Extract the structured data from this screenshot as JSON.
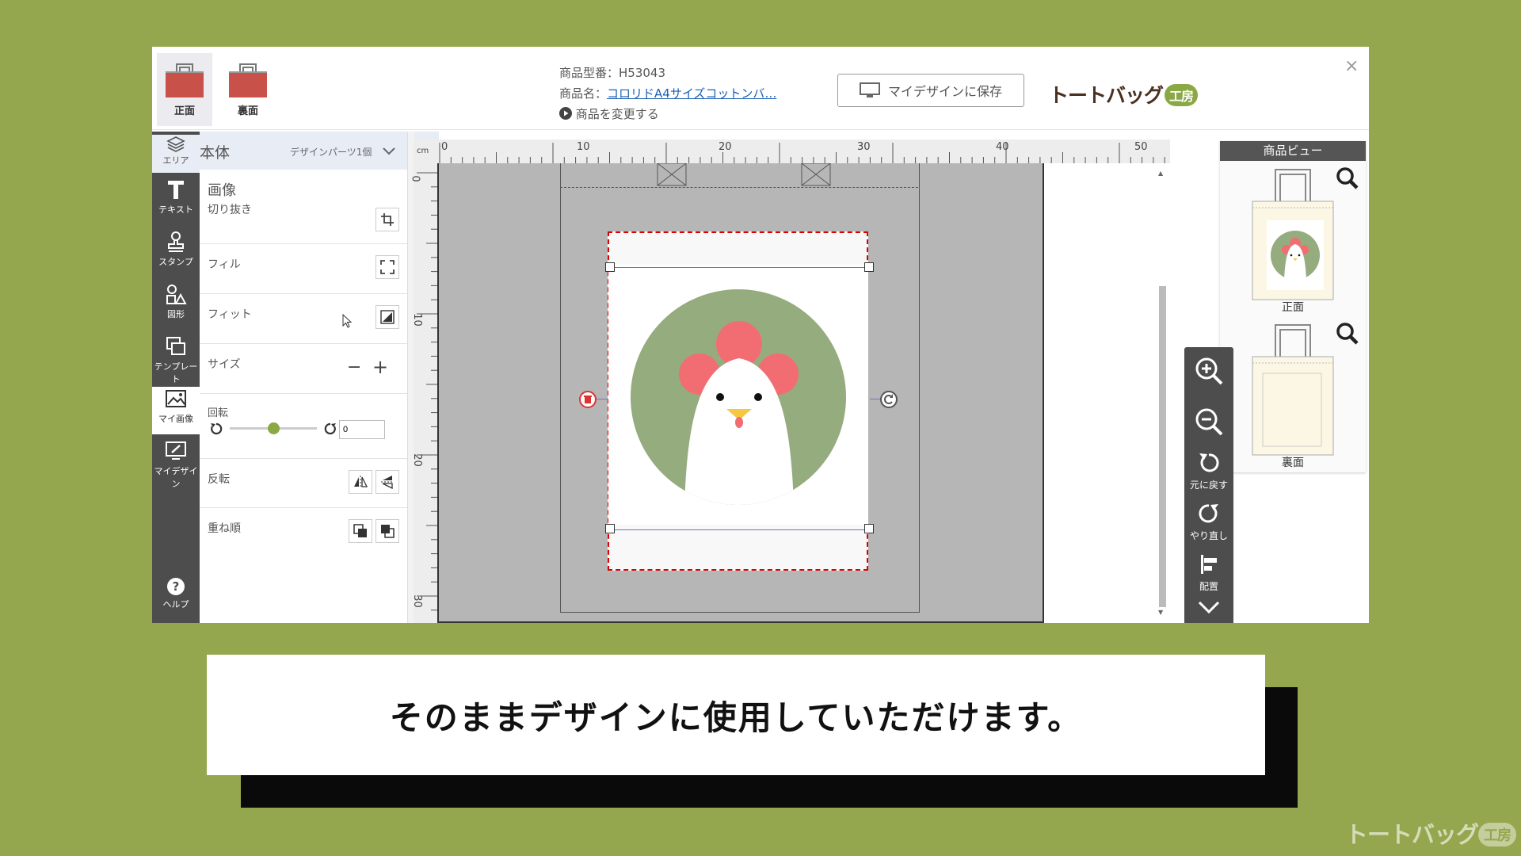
{
  "header": {
    "tabs": [
      {
        "label": "正面",
        "active": true
      },
      {
        "label": "裏面",
        "active": false
      }
    ],
    "product_code": "商品型番：H53043",
    "product_name_label": "商品名：",
    "product_name_link": "コロリドA4サイズコットンバ…",
    "change_product": "商品を変更する",
    "save_button": "マイデザインに保存",
    "logo_text": "トートバッグ",
    "logo_badge": "工房",
    "close": "×"
  },
  "toolrail": {
    "area": "エリア",
    "items": [
      {
        "label": "テキスト",
        "icon": "text-icon"
      },
      {
        "label": "スタンプ",
        "icon": "stamp-icon"
      },
      {
        "label": "図形",
        "icon": "shapes-icon"
      },
      {
        "label": "テンプレート",
        "icon": "template-icon"
      },
      {
        "label": "マイ画像",
        "icon": "image-icon",
        "active": true
      },
      {
        "label": "マイデザイン",
        "icon": "design-icon"
      }
    ],
    "help": "ヘルプ"
  },
  "panel": {
    "section": "本体",
    "parts_count": "デザインパーツ1個",
    "heading": "画像",
    "crop": "切り抜き",
    "fill": "フィル",
    "fit": "フィット",
    "size": "サイズ",
    "rotate": "回転",
    "rotate_value": "0",
    "rotate_fraction": 0.5,
    "flip": "反転",
    "order": "重ね順"
  },
  "ruler": {
    "unit": "cm",
    "h_labels": [
      "0",
      "10",
      "20",
      "30",
      "40",
      "50"
    ],
    "v_labels": [
      "0",
      "10",
      "20",
      "30"
    ]
  },
  "product_view": {
    "title": "商品ビュー",
    "front": "正面",
    "back": "裏面"
  },
  "zoom_rail": {
    "undo": "元に戻す",
    "redo": "やり直し",
    "align": "配置"
  },
  "caption": "そのままデザインに使用していただけます。",
  "watermark": {
    "text": "トートバッグ",
    "badge": "工房"
  },
  "colors": {
    "accent": "#94a74e",
    "bag": "#c8524a",
    "chicken_circle": "#95ac7e",
    "comb": "#f26d72",
    "selection": "#dd0000"
  }
}
